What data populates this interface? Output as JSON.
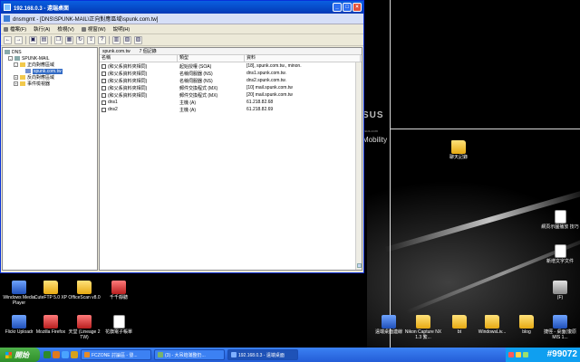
{
  "window": {
    "title": "192.168.0.3 - 遠端桌面",
    "subtitle": "dnsmgmt - [DNS\\SPUNK-MAIL\\正向對應區域\\spunk.com.tw]",
    "menu": [
      "檔案(F)",
      "執行(A)",
      "檢視(V)",
      "視窗(W)",
      "說明(H)"
    ],
    "tree": [
      {
        "label": "DNS",
        "icon": "server",
        "level": 0,
        "expander": ""
      },
      {
        "label": "SPUNK-MAIL",
        "icon": "server",
        "level": 1,
        "expander": "-"
      },
      {
        "label": "正向對應區域",
        "icon": "folder",
        "level": 2,
        "expander": "-"
      },
      {
        "label": "spunk.com.tw",
        "icon": "zone",
        "level": 3,
        "expander": "",
        "selected": true
      },
      {
        "label": "反向對應區域",
        "icon": "folder",
        "level": 2,
        "expander": "+"
      },
      {
        "label": "事件檢視器",
        "icon": "folder",
        "level": 2,
        "expander": "+"
      }
    ],
    "detail": {
      "zone": "spunk.com.tw",
      "count": "7 個記錄",
      "columns": [
        "名稱",
        "類型",
        "資料"
      ],
      "rows": [
        [
          "(和父系資料夾相同)",
          "起始授權 (SOA)",
          "[18], spunk.com.tw., minon."
        ],
        [
          "(和父系資料夾相同)",
          "名稱伺服器 (NS)",
          "dns1.spunk.com.tw."
        ],
        [
          "(和父系資料夾相同)",
          "名稱伺服器 (NS)",
          "dns2.spunk.com.tw."
        ],
        [
          "(和父系資料夾相同)",
          "郵件交換程式 (MX)",
          "[10]  mail.spunk.com.tw"
        ],
        [
          "(和父系資料夾相同)",
          "郵件交換程式 (MX)",
          "[20]  mail.spunk.com.tw"
        ],
        [
          "dns1",
          "主機 (A)",
          "61.218.82.68"
        ],
        [
          "dns2",
          "主機 (A)",
          "61.218.82.69"
        ]
      ]
    }
  },
  "desktop": {
    "brand": "SUS",
    "brand_url": "asus.com",
    "tagline": "Mobility",
    "icons": [
      {
        "label": "聊天記錄",
        "kind": "folder"
      },
      {
        "label": "網頁示圖播放 技巧",
        "kind": "doc"
      },
      {
        "label": "新增文字文件",
        "kind": "doc"
      },
      {
        "label": "(F)",
        "kind": "gray"
      },
      {
        "label": "Windows Media Player",
        "kind": "app"
      },
      {
        "label": "CuteFTP 5.0 XP",
        "kind": "folder"
      },
      {
        "label": "OfficeScan v8.0",
        "kind": "folder"
      },
      {
        "label": "千千靜聽",
        "kind": "red"
      },
      {
        "label": "Flickr Uploadr",
        "kind": "app"
      },
      {
        "label": "Mozilla Firefox",
        "kind": "red"
      },
      {
        "label": "天堂 (Lineage 2 TW)",
        "kind": "red"
      },
      {
        "label": "花旗電子帳單",
        "kind": "doc"
      },
      {
        "label": "遠端桌面連線",
        "kind": "app"
      },
      {
        "label": "Nikon Capture NX 1.3 繁...",
        "kind": "folder"
      },
      {
        "label": "bt",
        "kind": "folder"
      },
      {
        "label": "WindowsLiv...",
        "kind": "folder"
      },
      {
        "label": "blog",
        "kind": "folder"
      },
      {
        "label": "捷徑 - 桌面(復原 MIS 1...",
        "kind": "app"
      }
    ]
  },
  "taskbar": {
    "start": "開始",
    "items": [
      {
        "label": "FCZONE 討論區 - 發...",
        "color": "#e48b2a"
      },
      {
        "label": "(3) - 大吊炮滿整仍...",
        "color": "#7ab36b"
      },
      {
        "label": "192.168.0.3 - 遠端桌面",
        "color": "#7fb0ff",
        "active": true
      }
    ],
    "watermark": "#99072"
  },
  "colors": {
    "titlebar": "#0a5fe0",
    "taskbar": "#245dd7",
    "start": "#2f8f2a",
    "tray": "#0f9ff0"
  }
}
